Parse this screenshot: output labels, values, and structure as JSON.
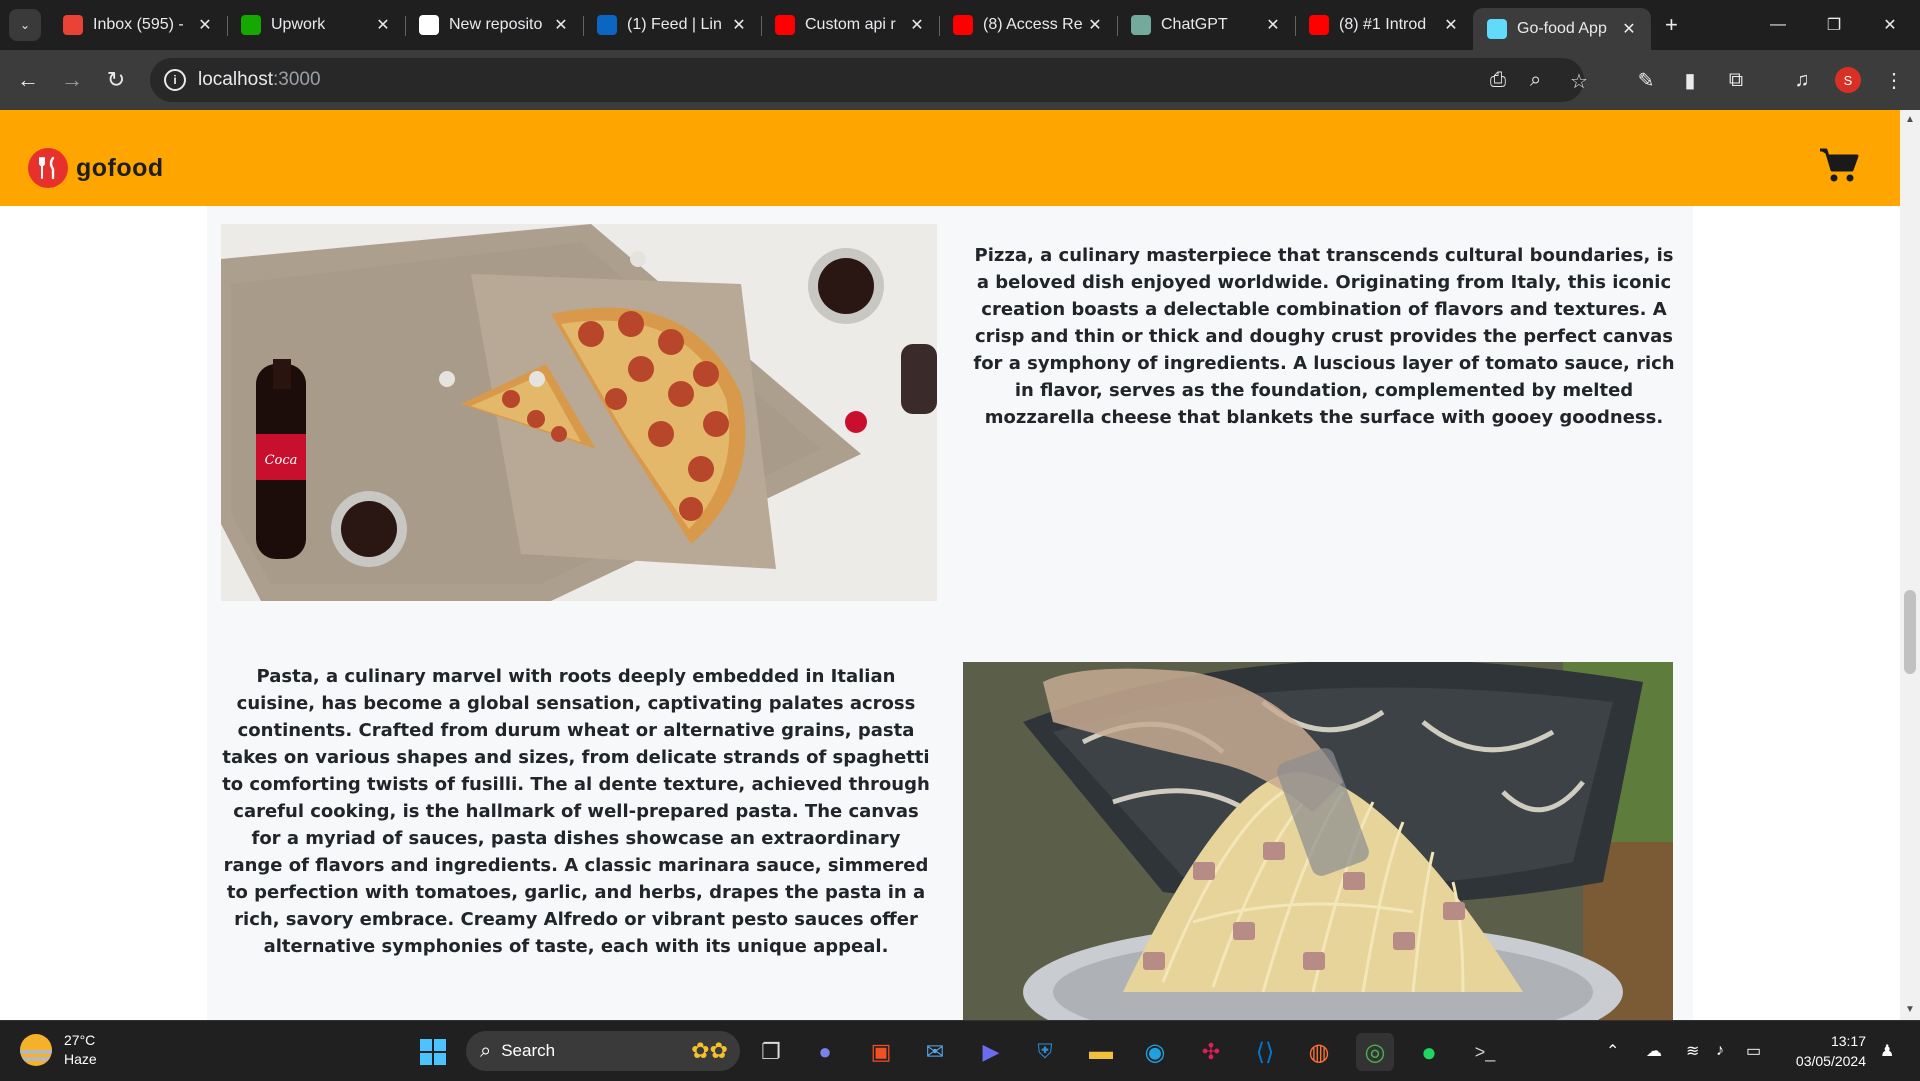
{
  "browser": {
    "tabs": [
      {
        "label": "Inbox (595) -",
        "icon": "gmail-icon",
        "color": "#ea4335",
        "active": false
      },
      {
        "label": "Upwork",
        "icon": "upwork-icon",
        "color": "#14a800",
        "active": false
      },
      {
        "label": "New reposito",
        "icon": "github-icon",
        "color": "#ffffff",
        "active": false
      },
      {
        "label": "(1) Feed | Lin",
        "icon": "linkedin-icon",
        "color": "#0a66c2",
        "active": false
      },
      {
        "label": "Custom api r",
        "icon": "youtube-icon",
        "color": "#ff0000",
        "active": false
      },
      {
        "label": "(8) Access Re",
        "icon": "youtube-icon",
        "color": "#ff0000",
        "active": false
      },
      {
        "label": "ChatGPT",
        "icon": "chatgpt-icon",
        "color": "#74aa9c",
        "active": false
      },
      {
        "label": "(8) #1 Introd",
        "icon": "youtube-icon",
        "color": "#ff0000",
        "active": false
      },
      {
        "label": "Go-food App",
        "icon": "react-icon",
        "color": "#61dafb",
        "active": true
      }
    ],
    "url": {
      "host": "localhost",
      "port": ":3000"
    },
    "profile_initial": "S"
  },
  "site": {
    "brand_name": "gofood",
    "colors": {
      "navbar": "#ffa500",
      "brand_logo": "#e7312d",
      "content_bg": "#f7f8fa"
    }
  },
  "items": [
    {
      "name": "Pizza",
      "image_icon": "pizza-photo",
      "description": "Pizza, a culinary masterpiece that transcends cultural boundaries, is a beloved dish enjoyed worldwide. Originating from Italy, this iconic creation boasts a delectable combination of flavors and textures. A crisp and thin or thick and doughy crust provides the perfect canvas for a symphony of ingredients. A luscious layer of tomato sauce, rich in flavor, serves as the foundation, complemented by melted mozzarella cheese that blankets the surface with gooey goodness."
    },
    {
      "name": "Pasta",
      "image_icon": "pasta-photo",
      "description": "Pasta, a culinary marvel with roots deeply embedded in Italian cuisine, has become a global sensation, captivating palates across continents. Crafted from durum wheat or alternative grains, pasta takes on various shapes and sizes, from delicate strands of spaghetti to comforting twists of fusilli. The al dente texture, achieved through careful cooking, is the hallmark of well-prepared pasta. The canvas for a myriad of sauces, pasta dishes showcase an extraordinary range of flavors and ingredients. A classic marinara sauce, simmered to perfection with tomatoes, garlic, and herbs, drapes the pasta in a rich, savory embrace. Creamy Alfredo or vibrant pesto sauces offer alternative symphonies of taste, each with its unique appeal."
    }
  ],
  "taskbar": {
    "weather": {
      "temp": "27°C",
      "condition": "Haze"
    },
    "search_label": "Search",
    "time": "13:17",
    "date": "03/05/2024"
  }
}
